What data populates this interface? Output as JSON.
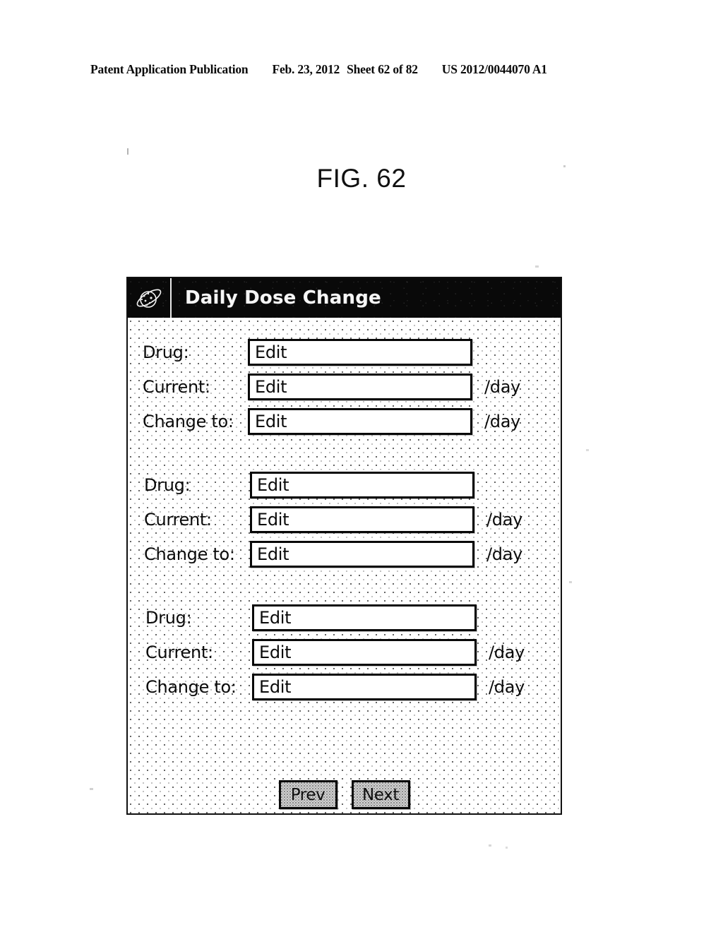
{
  "page_header": {
    "publication": "Patent Application Publication",
    "date": "Feb. 23, 2012",
    "sheet": "Sheet 62 of 82",
    "publication_number": "US 2012/0044070 A1"
  },
  "figure": {
    "caption": "FIG. 62"
  },
  "dialog": {
    "title": "Daily Dose Change",
    "title_icon": "saturn-planet-icon",
    "colors": {
      "titlebar_background": "#0b0b0b",
      "titlebar_text": "#f4f4f4",
      "body_background": "#ffffff",
      "field_border": "#0a0a0a",
      "button_face": "#cfcfcf"
    },
    "groups": [
      {
        "rows": [
          {
            "label": "Drug:",
            "value": "Edit",
            "placeholder": "Edit",
            "unit": ""
          },
          {
            "label": "Current:",
            "value": "Edit",
            "placeholder": "Edit",
            "unit": "/day"
          },
          {
            "label": "Change to:",
            "value": "Edit",
            "placeholder": "Edit",
            "unit": "/day"
          }
        ]
      },
      {
        "rows": [
          {
            "label": "Drug:",
            "value": "Edit",
            "placeholder": "Edit",
            "unit": ""
          },
          {
            "label": "Current:",
            "value": "Edit",
            "placeholder": "Edit",
            "unit": "/day"
          },
          {
            "label": "Change to:",
            "value": "Edit",
            "placeholder": "Edit",
            "unit": "/day"
          }
        ]
      },
      {
        "rows": [
          {
            "label": "Drug:",
            "value": "Edit",
            "placeholder": "Edit",
            "unit": ""
          },
          {
            "label": "Current:",
            "value": "Edit",
            "placeholder": "Edit",
            "unit": "/day"
          },
          {
            "label": "Change to:",
            "value": "Edit",
            "placeholder": "Edit",
            "unit": "/day"
          }
        ]
      }
    ],
    "buttons": {
      "prev_label": "Prev",
      "next_label": "Next"
    }
  }
}
